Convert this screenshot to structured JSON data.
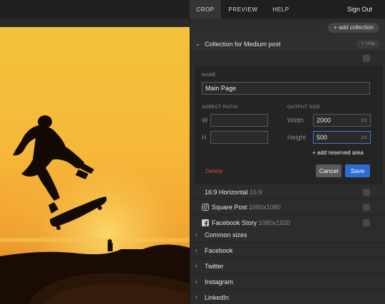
{
  "tabs": [
    {
      "label": "CROP",
      "active": true
    },
    {
      "label": "PREVIEW",
      "active": false
    },
    {
      "label": "HELP",
      "active": false
    }
  ],
  "signout": "Sign Out",
  "add_collection": "+ add collection",
  "collection": {
    "title": "Collection for Medium post",
    "crop_pill": "+ crop",
    "form": {
      "name_label": "NAME",
      "name_value": "Main Page",
      "aspect_label": "ASPECT RATIO",
      "w_label": "W",
      "h_label": "H",
      "w_value": "",
      "h_value": "",
      "output_label": "OUTPUT SIZE",
      "width_label": "Width",
      "width_value": "2000",
      "height_label": "Height",
      "height_value": "500",
      "unit": "px",
      "add_reserved": "+ add reserved area",
      "delete": "Delete",
      "cancel": "Cancel",
      "save": "Save"
    }
  },
  "presets": [
    {
      "name": "16:9 Horizontal",
      "dim": "16:9",
      "icon": "none"
    },
    {
      "name": "Square Post",
      "dim": "1080x1080",
      "icon": "instagram-icon"
    },
    {
      "name": "Facebook Story",
      "dim": "1080x1920",
      "icon": "facebook-icon"
    }
  ],
  "collections": [
    {
      "name": "Common sizes"
    },
    {
      "name": "Facebook"
    },
    {
      "name": "Twitter"
    },
    {
      "name": "Instagram"
    },
    {
      "name": "LinkedIn"
    }
  ],
  "colors": {
    "accent": "#2d6cd1",
    "delete": "#d9473d",
    "panel": "#2e2e2e"
  }
}
